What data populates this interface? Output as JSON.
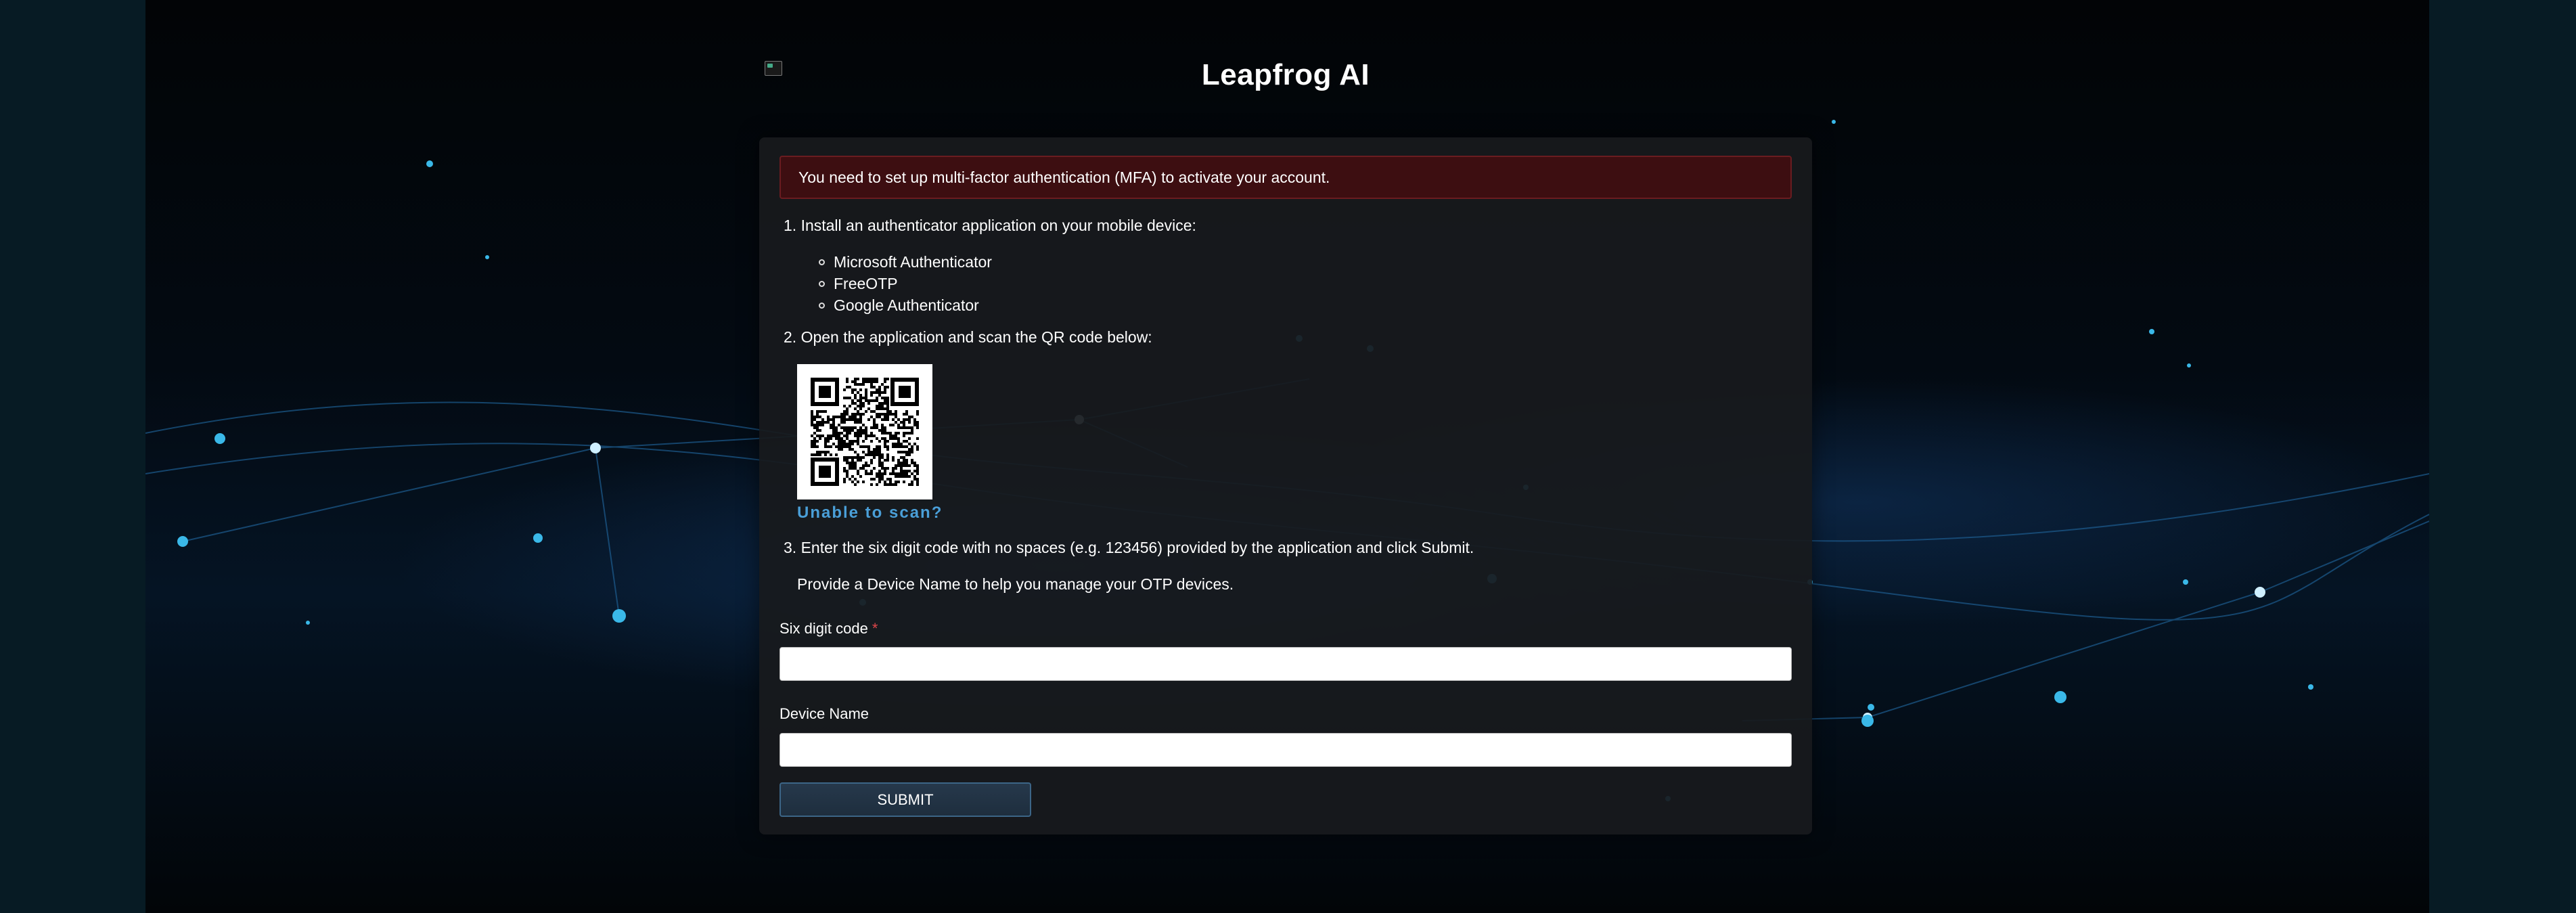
{
  "brand": {
    "title": "Leapfrog AI",
    "logo_icon": "broken-image-icon"
  },
  "alert": {
    "message": "You need to set up multi-factor authentication (MFA) to activate your account.",
    "color": "#3d0e11"
  },
  "steps": {
    "step1": "1. Install an authenticator application on your mobile device:",
    "apps": [
      "Microsoft Authenticator",
      "FreeOTP",
      "Google Authenticator"
    ],
    "step2": "2. Open the application and scan the QR code below:",
    "unable_to_scan": "Unable to scan?",
    "step3": "3. Enter the six digit code with no spaces (e.g. 123456) provided by the application and click Submit.",
    "device_hint": "Provide a Device Name to help you manage your OTP devices."
  },
  "form": {
    "otp_label": "Six digit code",
    "otp_required_mark": "*",
    "otp_value": "",
    "device_label": "Device Name",
    "device_value": "",
    "submit_label": "SUBMIT"
  },
  "colors": {
    "accent": "#4a9fd8",
    "required": "#e0464a",
    "card": "#181a1d",
    "button": "#26384b"
  }
}
